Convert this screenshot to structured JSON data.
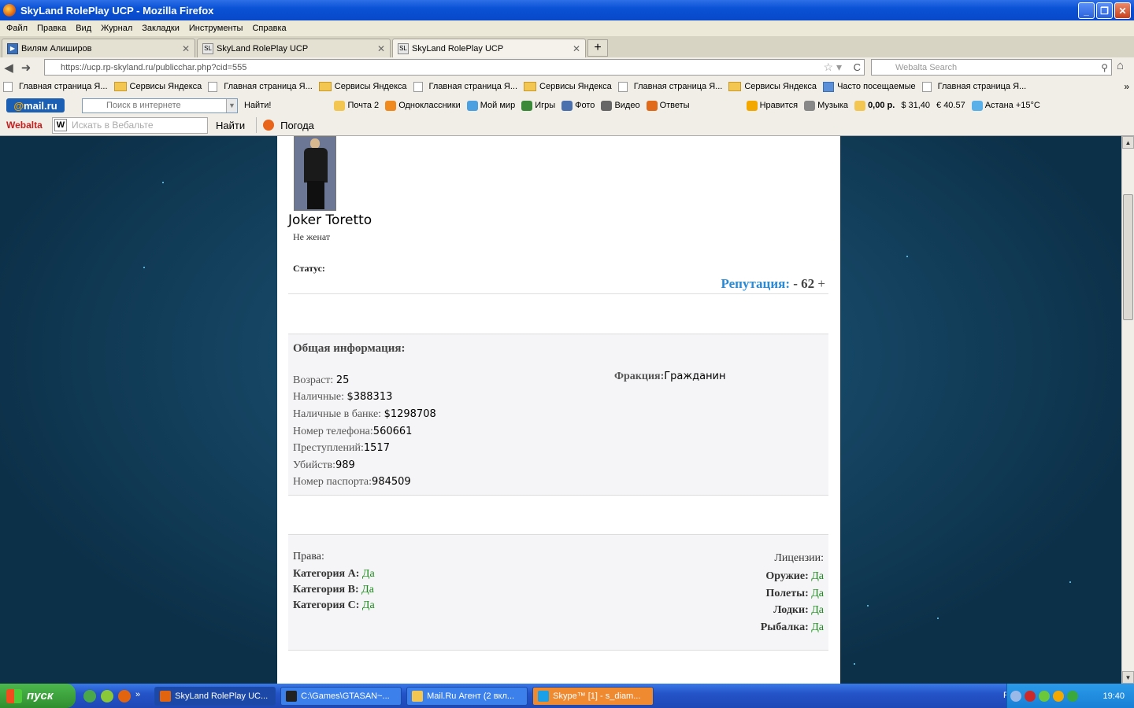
{
  "window": {
    "title": "SkyLand RolePlay UCP - Mozilla Firefox",
    "btn_min": "_",
    "btn_max": "❐",
    "btn_close": "✕"
  },
  "menu": [
    "Файл",
    "Правка",
    "Вид",
    "Журнал",
    "Закладки",
    "Инструменты",
    "Справка"
  ],
  "tabs": [
    {
      "label": "Вилям Алиширов",
      "fav": "▶"
    },
    {
      "label": "SkyLand RolePlay UCP",
      "fav": "SL"
    },
    {
      "label": "SkyLand RolePlay UCP",
      "fav": "SL"
    }
  ],
  "tab_close": "✕",
  "new_tab": "+",
  "nav": {
    "back": "◀",
    "forward": "➜",
    "url": "https://ucp.rp-skyland.ru/publicchar.php?cid=555",
    "star": "☆ ▾",
    "reload": "C",
    "search_placeholder": "Webalta Search",
    "search_icon": "⚲",
    "home_icon": "⌂"
  },
  "bookmarks": [
    {
      "type": "page",
      "label": "Главная страница Я..."
    },
    {
      "type": "folder",
      "label": "Сервисы Яндекса"
    },
    {
      "type": "page",
      "label": "Главная страница Я..."
    },
    {
      "type": "folder",
      "label": "Сервисы Яндекса"
    },
    {
      "type": "page",
      "label": "Главная страница Я..."
    },
    {
      "type": "folder",
      "label": "Сервисы Яндекса"
    },
    {
      "type": "page",
      "label": "Главная страница Я..."
    },
    {
      "type": "folder",
      "label": "Сервисы Яндекса"
    },
    {
      "type": "icon",
      "label": "Часто посещаемые"
    },
    {
      "type": "page",
      "label": "Главная страница Я..."
    }
  ],
  "bookmarks_more": "»",
  "mailbar": {
    "logo_at": "@",
    "logo": "mail.ru",
    "search_placeholder": "Поиск в интернете",
    "search_dd": "▼",
    "find": "Найти!",
    "items": [
      {
        "label": "Почта 2",
        "color": "#f2c650"
      },
      {
        "label": "Одноклассники",
        "color": "#f08a1e"
      },
      {
        "label": "Мой мир",
        "color": "#4aa0e0"
      },
      {
        "label": "Игры",
        "color": "#3a8a3a"
      },
      {
        "label": "Фото",
        "color": "#4a70b0"
      },
      {
        "label": "Видео",
        "color": "#666666"
      },
      {
        "label": "Ответы",
        "color": "#e06a1a"
      }
    ],
    "right": [
      {
        "label": "Нравится",
        "color": "#f2a800"
      },
      {
        "label": "Музыка",
        "color": "#888888"
      },
      {
        "label": "0,00 р.",
        "color": "#f2c650"
      },
      {
        "label": "$ 31,40",
        "color": "#cc2a2a"
      },
      {
        "label": "€ 40.57",
        "color": "#2a9a2a"
      },
      {
        "label": "Астана +15°C",
        "color": "#5ab0e8"
      }
    ]
  },
  "webalta": {
    "logo": "Webalta",
    "w": "W",
    "placeholder": "Искать в Вебальте",
    "find": "Найти",
    "weather": "Погода"
  },
  "character": {
    "name": "Joker Toretto",
    "marital": "Не женат",
    "status_label": "Статус:",
    "rep_label": "Репутация:",
    "rep_minus": "-",
    "rep_value": "62",
    "rep_plus": "+"
  },
  "general": {
    "title": "Общая информация:",
    "rows": [
      {
        "label": "Возраст:",
        "value": "25"
      },
      {
        "label": "Наличные:",
        "value": "$388313"
      },
      {
        "label": "Наличные в банке:",
        "value": "$1298708"
      },
      {
        "label": "Номер телефона:",
        "value": "560661"
      },
      {
        "label": "Преступлений:",
        "value": "1517"
      },
      {
        "label": "Убийств:",
        "value": "989"
      },
      {
        "label": "Номер паспорта:",
        "value": "984509"
      }
    ],
    "faction_label": "Фракция:",
    "faction_value": "Гражданин"
  },
  "licenses": {
    "rights_title": "Права:",
    "rights": [
      {
        "label": "Категория A:",
        "value": "Да"
      },
      {
        "label": "Категория B:",
        "value": "Да"
      },
      {
        "label": "Категория C:",
        "value": "Да"
      }
    ],
    "lic_title": "Лицензии:",
    "lic": [
      {
        "label": "Оружие:",
        "value": "Да"
      },
      {
        "label": "Полеты:",
        "value": "Да"
      },
      {
        "label": "Лодки:",
        "value": "Да"
      },
      {
        "label": "Рыбалка:",
        "value": "Да"
      }
    ]
  },
  "scroll": {
    "up": "▲",
    "down": "▼"
  },
  "taskbar": {
    "start": "пуск",
    "more": "»",
    "tasks": [
      {
        "label": "SkyLand RolePlay UC...",
        "color": "#e2640e"
      },
      {
        "label": "C:\\Games\\GTASAN~...",
        "color": "#222222"
      },
      {
        "label": "Mail.Ru Агент (2 вкл...",
        "color": "#f2c650"
      },
      {
        "label": "Skype™ [1] - s_diam...",
        "color": "#1aa0e8"
      }
    ],
    "lang": "RU",
    "clock": "19:40"
  }
}
